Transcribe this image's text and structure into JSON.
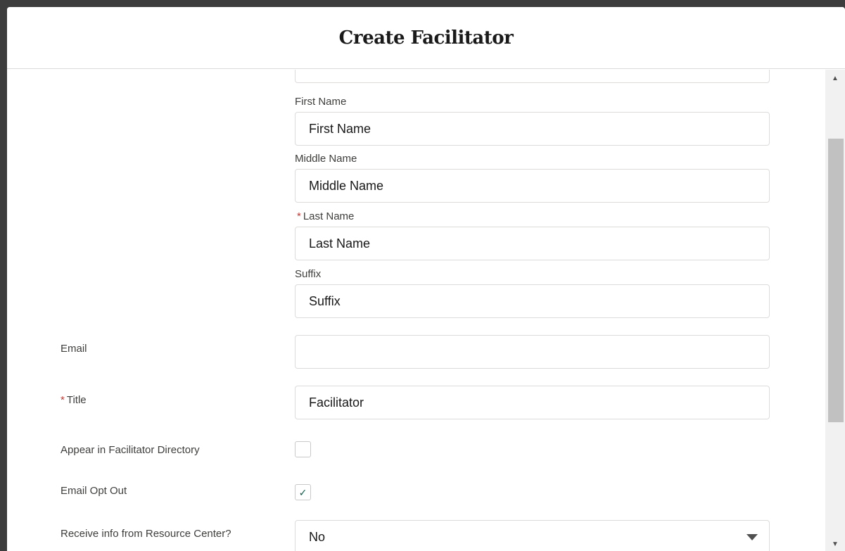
{
  "modal": {
    "title": "Create Facilitator"
  },
  "name": {
    "first_label": "First Name",
    "first_placeholder": "First Name",
    "middle_label": "Middle Name",
    "middle_placeholder": "Middle Name",
    "last_required": "*",
    "last_label": "Last Name",
    "last_placeholder": "Last Name",
    "suffix_label": "Suffix",
    "suffix_placeholder": "Suffix"
  },
  "email": {
    "label": "Email",
    "value": ""
  },
  "title_field": {
    "required": "*",
    "label": "Title",
    "value": "Facilitator"
  },
  "directory": {
    "label": "Appear in Facilitator Directory",
    "checked": false
  },
  "opt_out": {
    "label": "Email Opt Out",
    "checked": true,
    "check_glyph": "✓"
  },
  "resource_center": {
    "label": "Receive info from Resource Center?",
    "selected": "No"
  },
  "icons": {
    "scroll_up": "▲",
    "scroll_down": "▼"
  },
  "colors": {
    "required": "#c23934",
    "check": "#0b5e4a"
  }
}
